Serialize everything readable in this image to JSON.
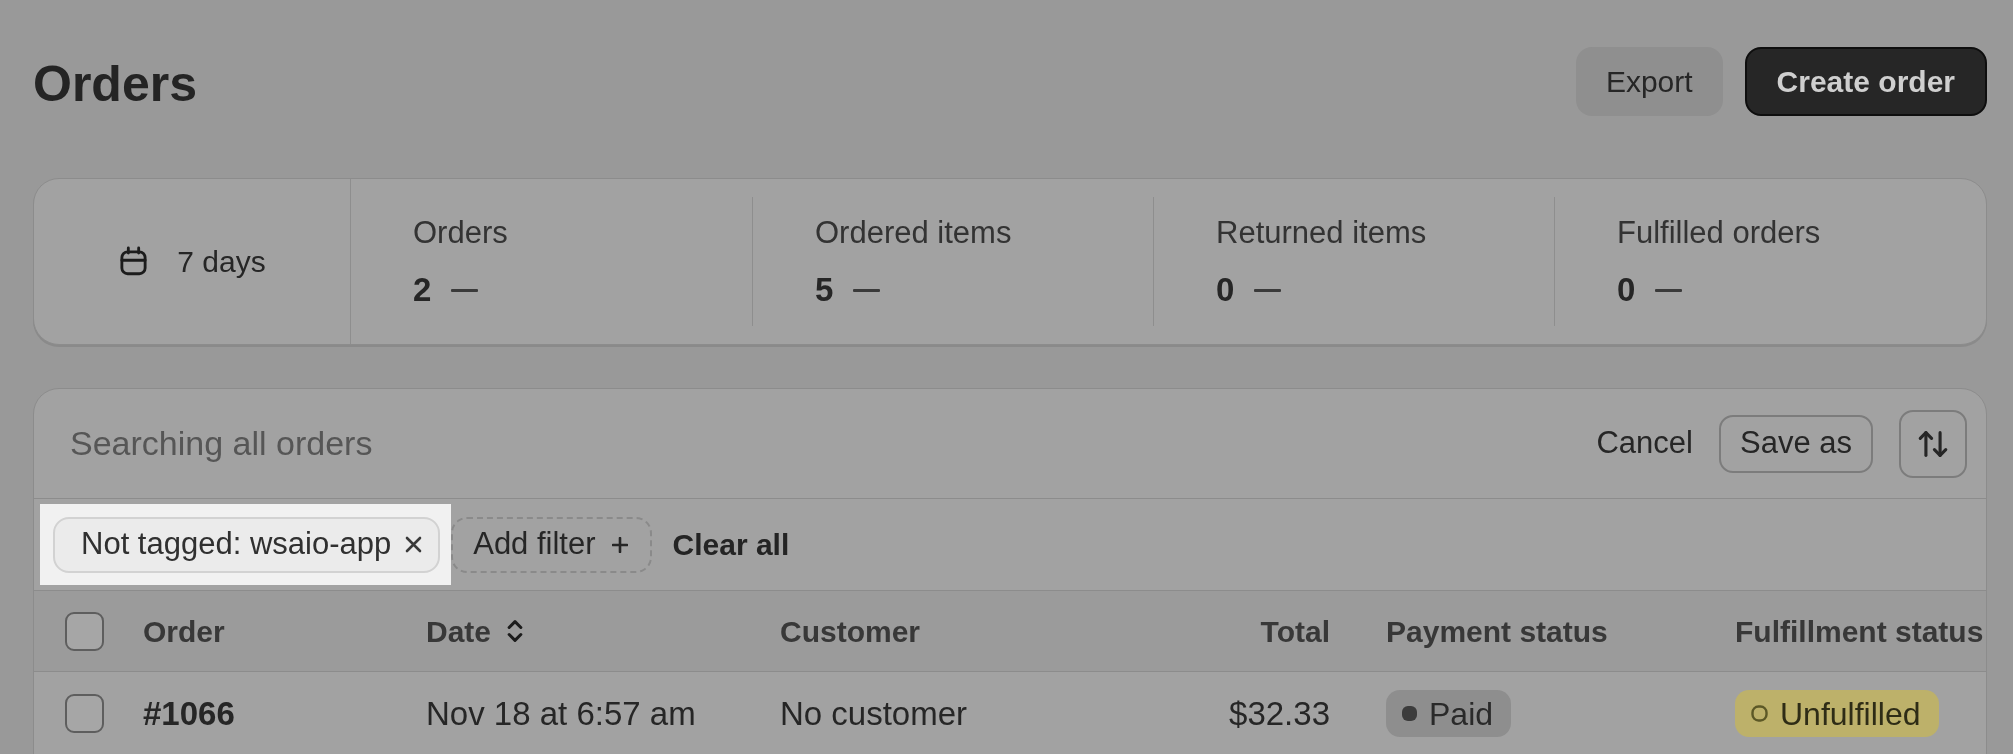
{
  "header": {
    "title": "Orders",
    "actions": [
      {
        "label": "Export",
        "kind": "secondary"
      },
      {
        "label": "Create order",
        "kind": "primary"
      }
    ]
  },
  "summary": {
    "date_range": "7 days",
    "metrics": [
      {
        "label": "Orders",
        "value": "2"
      },
      {
        "label": "Ordered items",
        "value": "5"
      },
      {
        "label": "Returned items",
        "value": "0"
      },
      {
        "label": "Fulfilled orders",
        "value": "0"
      }
    ]
  },
  "orders": {
    "search": {
      "placeholder": "Searching all orders"
    },
    "actions": [
      {
        "label": "Cancel",
        "kind": "plain"
      },
      {
        "label": "Save as",
        "kind": "outlined"
      }
    ],
    "filters": [
      {
        "label": "Not tagged: wsaio-app",
        "highlighted": true
      }
    ],
    "add_filter": "Add filter",
    "clear_all": "Clear all",
    "select_all": {
      "checked": false
    },
    "columns": [
      {
        "label": "Order",
        "kind": "id",
        "sortable": false
      },
      {
        "label": "Date",
        "kind": "text",
        "sortable": true
      },
      {
        "label": "Customer",
        "kind": "text",
        "sortable": false
      },
      {
        "label": "Total",
        "kind": "currency",
        "sortable": false
      },
      {
        "label": "Payment status",
        "kind": "status",
        "sortable": false
      },
      {
        "label": "Fulfillment status",
        "kind": "status",
        "sortable": false
      }
    ],
    "rows": [
      {
        "selected": false,
        "cells": [
          "#1066",
          "Nov 18 at 6:57 am",
          "No customer",
          "$32.33",
          {
            "label": "Paid",
            "kind": "neutral"
          },
          {
            "label": "Unfulfilled",
            "kind": "attention"
          }
        ]
      }
    ]
  }
}
